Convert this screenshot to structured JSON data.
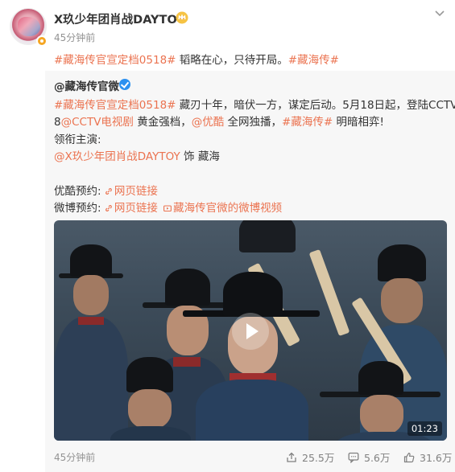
{
  "post": {
    "username": "X玖少年团肖战DAYTOY",
    "timestamp": "45分钟前",
    "content": {
      "tag1": "#藏海传官宣定档0518#",
      "text": " 韬略在心，只待开局。",
      "tag2": "#藏海传#"
    }
  },
  "retweet": {
    "author": "@藏海传官微",
    "line1_tag": "#藏海传官宣定档0518#",
    "line1_text": " 藏刃十年，暗伏一方，谋定后动。5月18日起，登陆CCTV-",
    "line2_start": "8",
    "line2_link1": "@CCTV电视剧",
    "line2_mid": " 黄金强档，",
    "line2_link2": "@优酷",
    "line2_mid2": " 全网独播，",
    "line2_tag": "#藏海传#",
    "line2_end": " 明暗相弈!",
    "line3": "领衔主演:",
    "line4_link": "@X玖少年团肖战DAYTOY",
    "line4_text": " 饰 藏海",
    "line5_label": "优酷预约:",
    "line5_link": "网页链接",
    "line6_label": "微博预约:",
    "line6_link1": "网页链接",
    "line6_link2": "藏海传官微的微博视频",
    "video_duration": "01:23",
    "footer": {
      "timestamp": "45分钟前",
      "reposts": "25.5万",
      "comments": "5.6万",
      "likes": "31.6万"
    }
  },
  "colors": {
    "accent": "#eb7350",
    "muted": "#939393",
    "retweet_bg": "#f7f7f7",
    "verified_blue": "#2c91f0",
    "verified_orange": "#f5a623"
  },
  "icons": [
    "chevron-down-icon",
    "crown-icon",
    "link-icon",
    "video-icon",
    "play-icon",
    "repost-icon",
    "comment-icon",
    "like-icon"
  ]
}
